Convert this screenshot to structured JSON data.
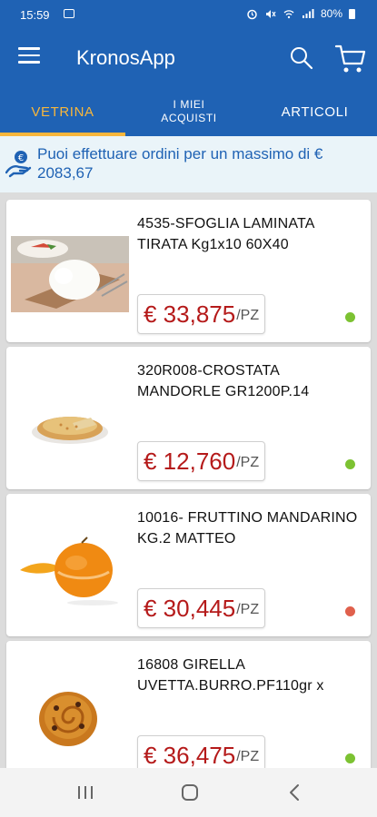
{
  "status_bar": {
    "time": "15:59",
    "battery": "80%"
  },
  "app_bar": {
    "title": "KronosApp"
  },
  "tabs": [
    {
      "label": "VETRINA"
    },
    {
      "label": "I MIEI ACQUISTI"
    },
    {
      "label": "ARTICOLI"
    }
  ],
  "notice": {
    "text": "Puoi effettuare ordini per un massimo di € 2083,67"
  },
  "products": [
    {
      "name": "4535-SFOGLIA LAMINATA TIRATA Kg1x10 60X40",
      "price": "€ 33,875",
      "unit": "/PZ",
      "available": true
    },
    {
      "name": "320R008-CROSTATA MANDORLE GR1200P.14",
      "price": "€ 12,760",
      "unit": "/PZ",
      "available": true
    },
    {
      "name": "10016- FRUTTINO MANDARINO KG.2 MATTEO",
      "price": "€ 30,445",
      "unit": "/PZ",
      "available": false
    },
    {
      "name": "16808 GIRELLA UVETTA.BURRO.PF110gr x",
      "price": "€ 36,475",
      "unit": "/PZ",
      "available": true
    }
  ],
  "colors": {
    "primary": "#1f62b4",
    "accent": "#f7b63c",
    "price": "#b51a1a",
    "available": "#7cc232",
    "unavailable": "#e0604c"
  },
  "icons": [
    "menu-icon",
    "search-icon",
    "cart-icon",
    "hand-coin-icon",
    "recents-icon",
    "home-icon",
    "back-icon"
  ]
}
